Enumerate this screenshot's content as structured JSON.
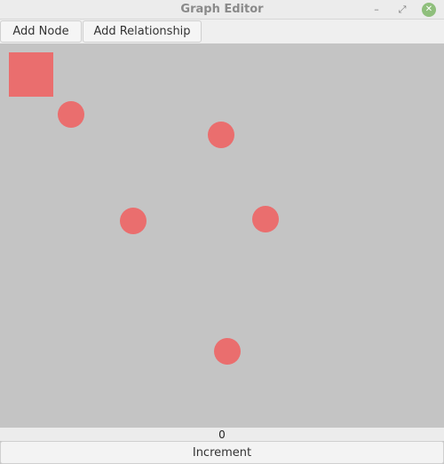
{
  "window": {
    "title": "Graph Editor",
    "minimize_glyph": "–",
    "restore_glyph": "⤢",
    "close_glyph": "✕"
  },
  "toolbar": {
    "add_node_label": "Add Node",
    "add_relationship_label": "Add Relationship"
  },
  "canvas": {
    "background": "#c4c4c4",
    "node_color": "#ea6e6e",
    "nodes": [
      {
        "shape": "square"
      },
      {
        "shape": "circle"
      },
      {
        "shape": "circle"
      },
      {
        "shape": "circle"
      },
      {
        "shape": "circle"
      },
      {
        "shape": "circle"
      }
    ]
  },
  "counter": {
    "value": "0"
  },
  "footer": {
    "increment_label": "Increment"
  }
}
